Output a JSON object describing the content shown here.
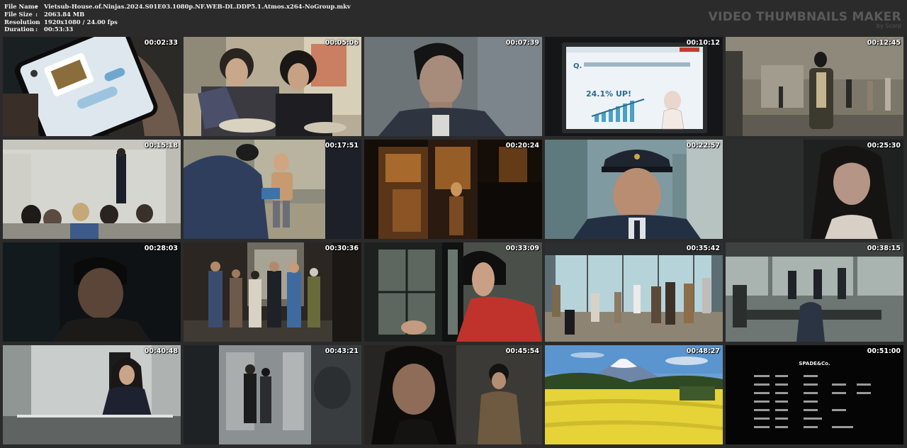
{
  "file_info": {
    "rows": [
      {
        "label": "File Name",
        "value": "Vietsub-House.of.Ninjas.2024.S01E03.1080p.NF.WEB-DL.DDP5.1.Atmos.x264-NoGroup.mkv"
      },
      {
        "label": "File Size",
        "value": "2063.84 MB"
      },
      {
        "label": "Resolution",
        "value": "1920x1080 / 24.00 fps"
      },
      {
        "label": "Duration",
        "value": "00:53:33"
      }
    ],
    "separator": ":"
  },
  "brand": {
    "title": "VIDEO THUMBNAILS MAKER",
    "subtitle": "by Scorp"
  },
  "thumbnails": [
    {
      "time": "00:02:33",
      "scene": "phone-app"
    },
    {
      "time": "00:05:06",
      "scene": "two-people-eating"
    },
    {
      "time": "00:07:39",
      "scene": "young-man-closeup"
    },
    {
      "time": "00:10:12",
      "scene": "presentation-screen",
      "screen_text": "24.1% UP!"
    },
    {
      "time": "00:12:45",
      "scene": "office-lobby"
    },
    {
      "time": "00:15:18",
      "scene": "classroom"
    },
    {
      "time": "00:17:51",
      "scene": "boy-with-man"
    },
    {
      "time": "00:20:24",
      "scene": "dark-wooden-room"
    },
    {
      "time": "00:22:57",
      "scene": "police-officer"
    },
    {
      "time": "00:25:30",
      "scene": "woman-dark"
    },
    {
      "time": "00:28:03",
      "scene": "dark-face"
    },
    {
      "time": "00:30:36",
      "scene": "group-entrance"
    },
    {
      "time": "00:33:09",
      "scene": "woman-red-window"
    },
    {
      "time": "00:35:42",
      "scene": "glass-lobby-crowd"
    },
    {
      "time": "00:38:15",
      "scene": "empty-floor"
    },
    {
      "time": "00:40:48",
      "scene": "woman-desk"
    },
    {
      "time": "00:43:21",
      "scene": "hallway-door"
    },
    {
      "time": "00:45:54",
      "scene": "long-hair-man"
    },
    {
      "time": "00:48:27",
      "scene": "fuji-field"
    },
    {
      "time": "00:51:00",
      "scene": "end-credits",
      "credit_title": "SPADE&Co."
    }
  ]
}
